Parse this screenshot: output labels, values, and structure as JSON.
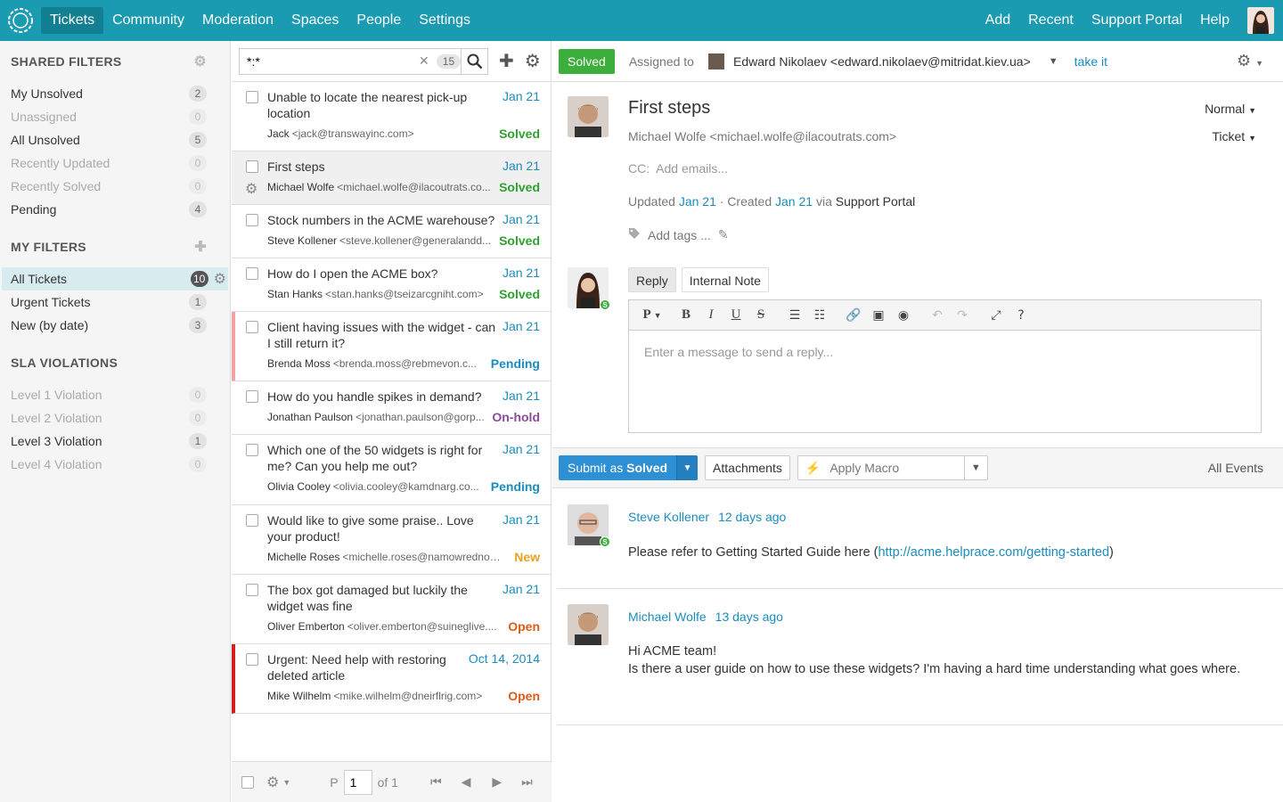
{
  "nav": {
    "items": [
      "Tickets",
      "Community",
      "Moderation",
      "Spaces",
      "People",
      "Settings"
    ],
    "right": [
      "Add",
      "Recent",
      "Support Portal",
      "Help"
    ]
  },
  "sidebar": {
    "shared_title": "SHARED FILTERS",
    "shared": [
      {
        "label": "My Unsolved",
        "count": "2"
      },
      {
        "label": "Unassigned",
        "count": "0"
      },
      {
        "label": "All Unsolved",
        "count": "5"
      },
      {
        "label": "Recently Updated",
        "count": "0"
      },
      {
        "label": "Recently Solved",
        "count": "0"
      },
      {
        "label": "Pending",
        "count": "4"
      }
    ],
    "my_title": "MY FILTERS",
    "my": [
      {
        "label": "All Tickets",
        "count": "10"
      },
      {
        "label": "Urgent Tickets",
        "count": "1"
      },
      {
        "label": "New (by date)",
        "count": "3"
      }
    ],
    "sla_title": "SLA VIOLATIONS",
    "sla": [
      {
        "label": "Level 1 Violation",
        "count": "0"
      },
      {
        "label": "Level 2 Violation",
        "count": "0"
      },
      {
        "label": "Level 3 Violation",
        "count": "1"
      },
      {
        "label": "Level 4 Violation",
        "count": "0"
      }
    ]
  },
  "search": {
    "value": "*:*",
    "count": "15"
  },
  "tickets": [
    {
      "title": "Unable to locate the nearest pick-up location",
      "date": "Jan 21",
      "name": "Jack",
      "email": "<jack@transwayinc.com>",
      "status": "Solved"
    },
    {
      "title": "First steps",
      "date": "Jan 21",
      "name": "Michael Wolfe",
      "email": "<michael.wolfe@ilacoutrats.co...",
      "status": "Solved"
    },
    {
      "title": "Stock numbers in the ACME warehouse?",
      "date": "Jan 21",
      "name": "Steve Kollener",
      "email": "<steve.kollener@generalandd...",
      "status": "Solved"
    },
    {
      "title": "How do I open the ACME box?",
      "date": "Jan 21",
      "name": "Stan Hanks",
      "email": "<stan.hanks@tseizarcgniht.com>",
      "status": "Solved"
    },
    {
      "title": "Client having issues with the widget - can I still return it?",
      "date": "Jan 21",
      "name": "Brenda Moss",
      "email": "<brenda.moss@rebmevon.c...",
      "status": "Pending"
    },
    {
      "title": "How do you handle spikes in demand?",
      "date": "Jan 21",
      "name": "Jonathan Paulson",
      "email": "<jonathan.paulson@gorp...",
      "status": "On-hold"
    },
    {
      "title": "Which one of the 50 widgets is right for me? Can you help me out?",
      "date": "Jan 21",
      "name": "Olivia Cooley",
      "email": "<olivia.cooley@kamdnarg.co...",
      "status": "Pending"
    },
    {
      "title": "Would like to give some praise.. Love your product!",
      "date": "Jan 21",
      "name": "Michelle Roses",
      "email": "<michelle.roses@namowrednow...",
      "status": "New"
    },
    {
      "title": "The box got damaged but luckily the widget was fine",
      "date": "Jan 21",
      "name": "Oliver Emberton",
      "email": "<oliver.emberton@suineglive....",
      "status": "Open"
    },
    {
      "title": "Urgent: Need help with restoring deleted article",
      "date": "Oct 14, 2014",
      "name": "Mike Wilhelm",
      "email": "<mike.wilhelm@dneirflrig.com>",
      "status": "Open"
    }
  ],
  "pager": {
    "p": "P",
    "page": "1",
    "of": "of 1"
  },
  "detail": {
    "status_btn": "Solved",
    "assigned_label": "Assigned to",
    "assignee": "Edward Nikolaev <edward.nikolaev@mitridat.kiev.ua>",
    "take_it": "take it",
    "title": "First steps",
    "from": "Michael Wolfe <michael.wolfe@ilacoutrats.com>",
    "priority": "Normal",
    "type": "Ticket",
    "cc_label": "CC:",
    "cc_placeholder": "Add emails...",
    "updated_label": "Updated",
    "updated": "Jan 21",
    "created_label": "· Created",
    "created": "Jan 21",
    "via_label": "via",
    "via": "Support Portal",
    "tags": "Add tags ...",
    "reply_tab": "Reply",
    "note_tab": "Internal Note",
    "editor_placeholder": "Enter a message to send a reply...",
    "submit_pre": "Submit as",
    "submit_status": "Solved",
    "attachments": "Attachments",
    "macro": "Apply Macro",
    "all_events": "All Events"
  },
  "events": [
    {
      "who": "Steve Kollener",
      "when": "12 days ago",
      "text_pre": "Please refer to Getting Started Guide here (",
      "link": "http://acme.helprace.com/getting-started",
      "text_post": ")"
    },
    {
      "who": "Michael Wolfe",
      "when": "13 days ago",
      "line1": "Hi ACME team!",
      "line2": "Is there a user guide on how to use these widgets? I'm having a hard time understanding what goes where."
    }
  ]
}
